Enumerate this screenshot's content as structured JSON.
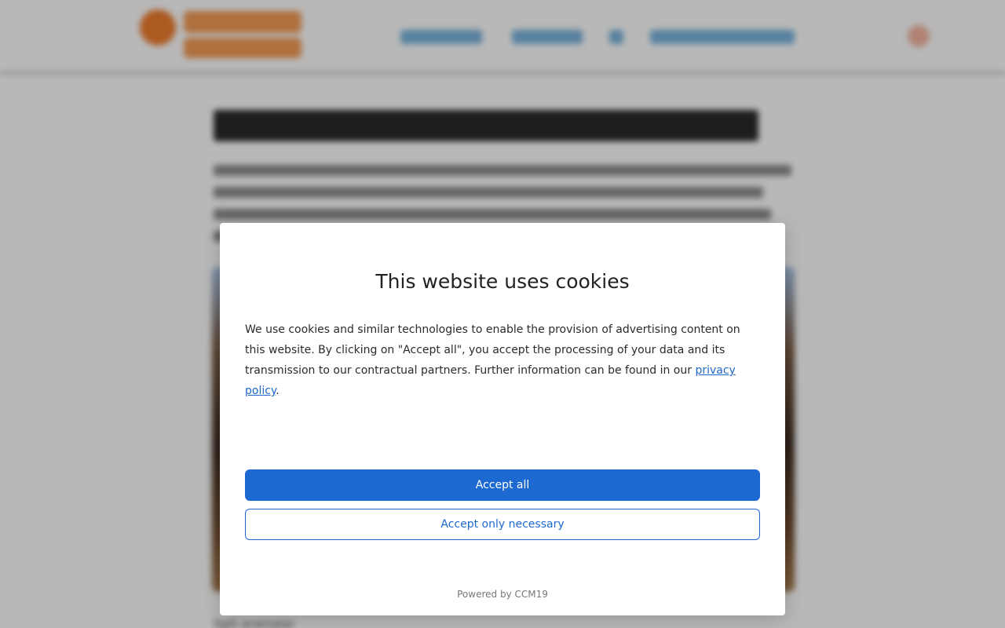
{
  "background_page": {
    "caption": "İlgili aramalar"
  },
  "cookie_dialog": {
    "title": "This website uses cookies",
    "body_text": "We use cookies and similar technologies to enable the provision of advertising content on this website. By clicking on \"Accept all\", you accept the processing of your data and its transmission to our contractual partners. Further information can be found in our ",
    "privacy_link": "privacy policy",
    "body_end": ".",
    "accept_all_label": "Accept all",
    "accept_necessary_label": "Accept only necessary",
    "powered_by": "Powered by CCM19"
  },
  "colors": {
    "primary": "#1d69d2",
    "link": "#1e69c6",
    "logo_orange": "#f07d2e"
  }
}
